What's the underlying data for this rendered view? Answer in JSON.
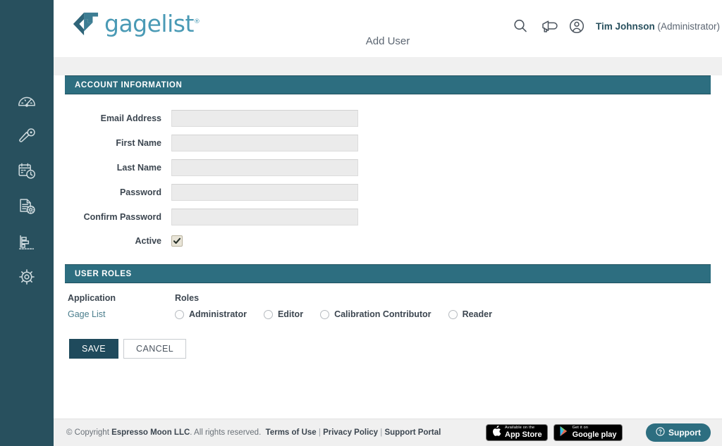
{
  "header": {
    "logo_text": "gagelist",
    "logo_registered": "®",
    "page_title": "Add User",
    "user_name": "Tim Johnson",
    "user_role": "(Administrator)",
    "icons": [
      "search-icon",
      "megaphone-icon",
      "account-circle-icon"
    ]
  },
  "sidebar": {
    "items": [
      {
        "name": "dashboard-gauge-icon",
        "label": "Dashboard"
      },
      {
        "name": "caliper-gage-icon",
        "label": "Gages"
      },
      {
        "name": "calendar-clock-icon",
        "label": "Schedule"
      },
      {
        "name": "document-gear-icon",
        "label": "Calibrations"
      },
      {
        "name": "bar-chart-icon",
        "label": "Reports"
      },
      {
        "name": "settings-gear-icon",
        "label": "Settings"
      }
    ]
  },
  "account_section": {
    "title": "ACCOUNT INFORMATION",
    "fields": [
      {
        "label": "Email Address",
        "value": "",
        "placeholder": ""
      },
      {
        "label": "First Name",
        "value": "",
        "placeholder": ""
      },
      {
        "label": "Last Name",
        "value": "",
        "placeholder": ""
      },
      {
        "label": "Password",
        "value": "",
        "placeholder": ""
      },
      {
        "label": "Confirm Password",
        "value": "",
        "placeholder": ""
      }
    ],
    "active_label": "Active",
    "active_checked": true
  },
  "roles_section": {
    "title": "USER ROLES",
    "application_header": "Application",
    "roles_header": "Roles",
    "application_name": "Gage List",
    "roles": [
      {
        "label": "Administrator",
        "selected": false
      },
      {
        "label": "Editor",
        "selected": false
      },
      {
        "label": "Calibration Contributor",
        "selected": false
      },
      {
        "label": "Reader",
        "selected": false
      }
    ]
  },
  "actions": {
    "save_label": "SAVE",
    "cancel_label": "CANCEL"
  },
  "footer": {
    "copyright_prefix": "© Copyright ",
    "company": "Espresso Moon LLC",
    "copyright_suffix": ". All rights reserved.",
    "links": [
      "Terms of Use",
      "Privacy Policy",
      "Support Portal"
    ],
    "separator": " | ",
    "app_store": {
      "small": "Available on the",
      "big": "App Store"
    },
    "google_play": {
      "small": "Get it on",
      "big": "Google play"
    },
    "support_label": "Support"
  },
  "colors": {
    "sidebar": "#28505e",
    "section_bar": "#2d6e80",
    "save_button": "#1f4a5c",
    "logo": "#4a9ab5",
    "link": "#4a7d8c",
    "band": "#f0f0f0"
  }
}
